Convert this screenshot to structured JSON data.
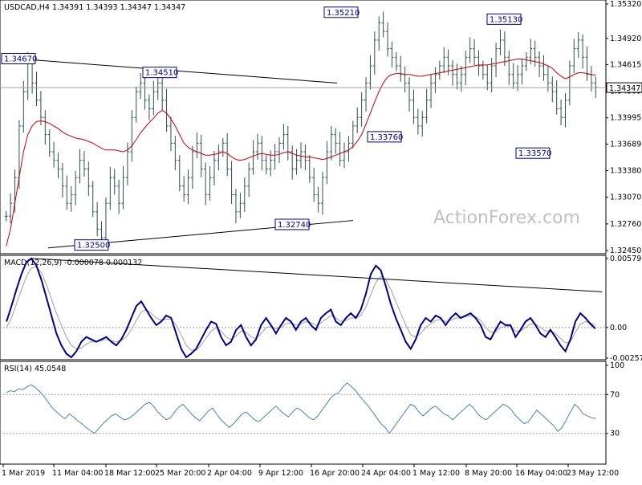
{
  "chart_data": [
    {
      "type": "candlestick",
      "panel": "price",
      "header": "USDCAD,H4  1.34391 1.34393 1.34347 1.34347",
      "watermark": "ActionForex.com",
      "ylim": [
        1.3245,
        1.3532
      ],
      "yticks": [
        "1.35320",
        "1.34920",
        "1.34615",
        "1.34305",
        "1.33995",
        "1.33689",
        "1.33380",
        "1.33070",
        "1.32760",
        "1.32450"
      ],
      "current_price": "1.34347",
      "annotations": [
        "1.34670",
        "1.34510",
        "1.33760",
        "1.32740",
        "1.32500",
        "1.35210",
        "1.35130",
        "1.33570"
      ],
      "approx_ohlc_closes": [
        1.3285,
        1.33,
        1.333,
        1.339,
        1.343,
        1.3466,
        1.344,
        1.342,
        1.34,
        1.338,
        1.336,
        1.335,
        1.334,
        1.332,
        1.33,
        1.331,
        1.333,
        1.335,
        1.334,
        1.332,
        1.329,
        1.327,
        1.326,
        1.33,
        1.333,
        1.332,
        1.33,
        1.333,
        1.336,
        1.34,
        1.343,
        1.344,
        1.342,
        1.341,
        1.343,
        1.344,
        1.342,
        1.339,
        1.337,
        1.335,
        1.332,
        1.331,
        1.333,
        1.336,
        1.337,
        1.334,
        1.331,
        1.333,
        1.335,
        1.336,
        1.337,
        1.334,
        1.331,
        1.329,
        1.33,
        1.332,
        1.334,
        1.336,
        1.337,
        1.335,
        1.334,
        1.335,
        1.336,
        1.337,
        1.338,
        1.336,
        1.334,
        1.335,
        1.336,
        1.335,
        1.333,
        1.331,
        1.33,
        1.333,
        1.336,
        1.338,
        1.337,
        1.335,
        1.336,
        1.337,
        1.339,
        1.34,
        1.342,
        1.344,
        1.346,
        1.349,
        1.351,
        1.35,
        1.348,
        1.347,
        1.346,
        1.345,
        1.344,
        1.342,
        1.34,
        1.339,
        1.34,
        1.342,
        1.344,
        1.345,
        1.346,
        1.347,
        1.346,
        1.345,
        1.344,
        1.345,
        1.347,
        1.348,
        1.347,
        1.346,
        1.345,
        1.344,
        1.346,
        1.348,
        1.349,
        1.347,
        1.345,
        1.344,
        1.345,
        1.346,
        1.347,
        1.348,
        1.347,
        1.346,
        1.345,
        1.344,
        1.343,
        1.341,
        1.34,
        1.342,
        1.346,
        1.348,
        1.349,
        1.347,
        1.345,
        1.344,
        1.3435
      ],
      "sma_approx": [
        1.325,
        1.327,
        1.33,
        1.333,
        1.336,
        1.338,
        1.339,
        1.3395,
        1.3396,
        1.3395,
        1.3393,
        1.339,
        1.3387,
        1.3383,
        1.338,
        1.3378,
        1.3376,
        1.3375,
        1.3374,
        1.3372,
        1.337,
        1.3367,
        1.3364,
        1.3362,
        1.3362,
        1.3362,
        1.3361,
        1.336,
        1.3362,
        1.3367,
        1.3374,
        1.3382,
        1.3388,
        1.3394,
        1.3399,
        1.3405,
        1.3408,
        1.3405,
        1.3398,
        1.339,
        1.338,
        1.337,
        1.3365,
        1.3362,
        1.336,
        1.3358,
        1.3356,
        1.3356,
        1.3357,
        1.3358,
        1.336,
        1.3358,
        1.3354,
        1.3351,
        1.335,
        1.3351,
        1.3353,
        1.3355,
        1.3357,
        1.3358,
        1.3357,
        1.3356,
        1.3356,
        1.3357,
        1.3359,
        1.336,
        1.3358,
        1.3356,
        1.3355,
        1.3354,
        1.3354,
        1.3353,
        1.3352,
        1.3351,
        1.3352,
        1.3354,
        1.3356,
        1.3358,
        1.336,
        1.3362,
        1.3366,
        1.3372,
        1.338,
        1.3392,
        1.3405,
        1.3418,
        1.343,
        1.344,
        1.3447,
        1.345,
        1.3451,
        1.3451,
        1.345,
        1.345,
        1.3449,
        1.3448,
        1.3448,
        1.3449,
        1.345,
        1.3451,
        1.3452,
        1.3453,
        1.3454,
        1.3455,
        1.3456,
        1.3457,
        1.3458,
        1.3459,
        1.346,
        1.3461,
        1.3461,
        1.3461,
        1.3462,
        1.3463,
        1.3464,
        1.3465,
        1.3466,
        1.3467,
        1.3468,
        1.3468,
        1.3467,
        1.3466,
        1.3465,
        1.3464,
        1.3462,
        1.346,
        1.3457,
        1.3452,
        1.3448,
        1.3445,
        1.3447,
        1.345,
        1.3452,
        1.3452,
        1.3451,
        1.345,
        1.3449
      ]
    },
    {
      "type": "line",
      "panel": "macd",
      "header": "MACD(12,26,9) -0.000078 0.000132",
      "ylim": [
        -0.002573,
        0.005793
      ],
      "yticks": [
        "0.005793",
        "0.00",
        "-0.002573"
      ],
      "series": [
        {
          "values": [
            0.0005,
            0.0018,
            0.0032,
            0.0045,
            0.0055,
            0.0058,
            0.0052,
            0.004,
            0.0025,
            0.001,
            -0.0005,
            -0.0015,
            -0.0022,
            -0.0025,
            -0.002,
            -0.0012,
            -0.0008,
            -0.001,
            -0.0012,
            -0.001,
            -0.0008,
            -0.0012,
            -0.0015,
            -0.001,
            -0.0002,
            0.0008,
            0.0018,
            0.0022,
            0.0015,
            0.0008,
            0.0002,
            0.0005,
            0.001,
            0.0008,
            -0.0005,
            -0.0018,
            -0.0025,
            -0.0022,
            -0.0018,
            -0.001,
            -0.0002,
            0.0005,
            0.0003,
            -0.0008,
            -0.0015,
            -0.0012,
            -0.0002,
            0.0002,
            -0.0008,
            -0.0015,
            -0.001,
            0.0002,
            0.0008,
            0.0002,
            -0.0005,
            0.0002,
            0.0008,
            0.0005,
            -0.0002,
            0.0005,
            0.0008,
            0.0002,
            -0.0002,
            0.0008,
            0.0012,
            0.0015,
            0.0005,
            0.0002,
            0.0008,
            0.0012,
            0.0008,
            0.0015,
            0.0028,
            0.0045,
            0.0052,
            0.0048,
            0.0035,
            0.002,
            0.0008,
            -0.0002,
            -0.0012,
            -0.0018,
            -0.001,
            0.0002,
            0.0008,
            0.0005,
            0.001,
            0.0008,
            0.0002,
            0.0008,
            0.0012,
            0.0008,
            0.001,
            0.0012,
            0.0008,
            0.0002,
            -0.0008,
            -0.001,
            -0.0002,
            0.0005,
            0.0002,
            0.0002,
            -0.0008,
            -0.0002,
            0.0005,
            0.0008,
            0.0002,
            -0.0005,
            -0.0008,
            -0.0002,
            -0.0008,
            -0.0015,
            -0.002,
            -0.001,
            0.0005,
            0.0012,
            0.0008,
            0.0003,
            -0.0001
          ]
        },
        {
          "values": [
            0.0,
            0.0008,
            0.002,
            0.0032,
            0.0043,
            0.005,
            0.0051,
            0.0046,
            0.0036,
            0.0024,
            0.0012,
            0.0002,
            -0.0008,
            -0.0015,
            -0.0018,
            -0.0017,
            -0.0014,
            -0.0012,
            -0.0012,
            -0.0011,
            -0.001,
            -0.0011,
            -0.0012,
            -0.0011,
            -0.0008,
            -0.0002,
            0.0006,
            0.0013,
            0.0015,
            0.0012,
            0.0008,
            0.0006,
            0.0007,
            0.0007,
            0.0002,
            -0.0006,
            -0.0015,
            -0.0019,
            -0.0019,
            -0.0015,
            -0.0009,
            -0.0003,
            0.0,
            -0.0003,
            -0.0008,
            -0.001,
            -0.0007,
            -0.0003,
            -0.0004,
            -0.0008,
            -0.0009,
            -0.0005,
            0.0,
            0.0001,
            -0.0001,
            0.0,
            0.0003,
            0.0004,
            0.0002,
            0.0003,
            0.0005,
            0.0004,
            0.0002,
            0.0004,
            0.0007,
            0.001,
            0.0008,
            0.0005,
            0.0006,
            0.0008,
            0.0008,
            0.001,
            0.0017,
            0.0028,
            0.0038,
            0.0043,
            0.004,
            0.0032,
            0.0022,
            0.0012,
            0.0002,
            -0.0006,
            -0.0008,
            -0.0005,
            0.0,
            0.0003,
            0.0006,
            0.0007,
            0.0005,
            0.0006,
            0.0008,
            0.0008,
            0.0009,
            0.001,
            0.0009,
            0.0006,
            0.0,
            -0.0004,
            -0.0004,
            0.0,
            0.0001,
            0.0001,
            -0.0003,
            -0.0003,
            0.0,
            0.0003,
            0.0003,
            0.0,
            -0.0003,
            -0.0003,
            -0.0005,
            -0.0009,
            -0.0013,
            -0.0012,
            -0.0004,
            0.0003,
            0.0005,
            0.0004,
            0.0001
          ]
        }
      ]
    },
    {
      "type": "line",
      "panel": "rsi",
      "header": "RSI(14) 45.0548",
      "ylim": [
        0,
        100
      ],
      "yticks": [
        "100",
        "70",
        "30",
        "0"
      ],
      "levels": [
        70,
        30
      ],
      "series": [
        {
          "values": [
            72,
            74,
            73,
            76,
            75,
            78,
            80,
            77,
            73,
            68,
            62,
            56,
            52,
            48,
            45,
            50,
            47,
            43,
            40,
            36,
            33,
            30,
            35,
            40,
            44,
            48,
            50,
            47,
            44,
            45,
            48,
            52,
            56,
            60,
            62,
            58,
            52,
            48,
            44,
            46,
            52,
            57,
            60,
            55,
            50,
            46,
            43,
            48,
            53,
            56,
            50,
            44,
            40,
            36,
            40,
            45,
            50,
            52,
            48,
            44,
            42,
            46,
            50,
            54,
            58,
            54,
            50,
            47,
            52,
            56,
            54,
            50,
            46,
            44,
            48,
            54,
            60,
            66,
            70,
            72,
            78,
            82,
            78,
            74,
            68,
            63,
            58,
            52,
            46,
            40,
            36,
            30,
            36,
            42,
            48,
            54,
            60,
            58,
            52,
            48,
            52,
            56,
            58,
            54,
            50,
            48,
            44,
            48,
            52,
            56,
            60,
            56,
            50,
            46,
            44,
            48,
            52,
            56,
            60,
            58,
            54,
            48,
            44,
            40,
            42,
            48,
            54,
            50,
            46,
            42,
            38,
            32,
            36,
            44,
            52,
            60,
            56,
            50,
            48,
            46,
            45
          ]
        }
      ]
    }
  ],
  "xaxis": {
    "ticks": [
      "1 Mar 2019",
      "11 Mar 04:00",
      "18 Mar 12:00",
      "25 Mar 20:00",
      "2 Apr 04:00",
      "9 Apr 12:00",
      "16 Apr 20:00",
      "24 Apr 04:00",
      "1 May 12:00",
      "8 May 20:00",
      "16 May 04:00",
      "23 May 12:00"
    ]
  },
  "colors": {
    "candle": "#2f4f4f",
    "sma": "#cc0000",
    "macd": "#00008b",
    "signal": "#a0a0a0",
    "rsi": "#4682b4",
    "trendline": "#000000"
  }
}
